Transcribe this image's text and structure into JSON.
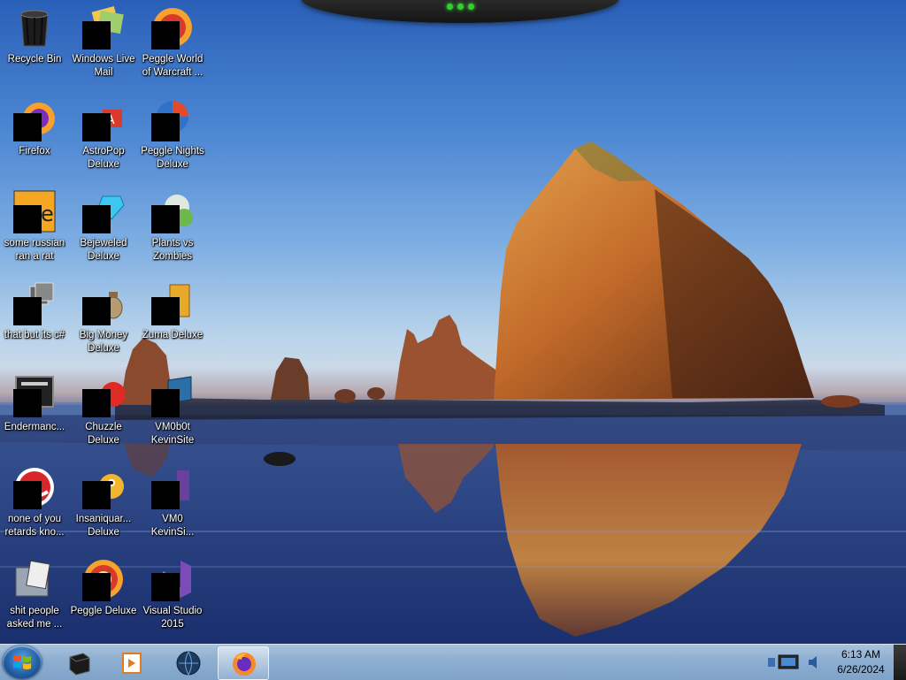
{
  "desktop": {
    "icons": [
      {
        "label": "Recycle Bin",
        "icon": "recycle-bin-icon"
      },
      {
        "label": "Windows Live\nMail",
        "icon": "windows-live-mail-icon"
      },
      {
        "label": "Peggle World\nof Warcraft ...",
        "icon": "peggle-wow-icon"
      },
      {
        "label": "Firefox",
        "icon": "firefox-icon"
      },
      {
        "label": "AstroPop\nDeluxe",
        "icon": "astropop-icon"
      },
      {
        "label": "Peggle Nights\nDeluxe",
        "icon": "peggle-nights-icon"
      },
      {
        "label": "some russian\nran a rat",
        "icon": "russian-app-icon"
      },
      {
        "label": "Bejeweled\nDeluxe",
        "icon": "bejeweled-icon"
      },
      {
        "label": "Plants vs\nZombies",
        "icon": "plants-vs-zombies-icon"
      },
      {
        "label": "that but its c#",
        "icon": "shortcut-stack-icon"
      },
      {
        "label": "Big Money\nDeluxe",
        "icon": "big-money-icon"
      },
      {
        "label": "Zuma Deluxe",
        "icon": "zuma-icon"
      },
      {
        "label": "Endermanc...",
        "icon": "endermanch-icon"
      },
      {
        "label": "Chuzzle\nDeluxe",
        "icon": "chuzzle-icon"
      },
      {
        "label": "VM0b0t\nKevinSite",
        "icon": "vm-folder-icon"
      },
      {
        "label": "none of you\nretards kno...",
        "icon": "red-ball-icon"
      },
      {
        "label": "Insaniquar...\nDeluxe",
        "icon": "insaniquarium-icon"
      },
      {
        "label": "VM0\nKevinSi...",
        "icon": "vm-purple-icon"
      },
      {
        "label": "shit people\nasked me ...",
        "icon": "folder-doc-icon"
      },
      {
        "label": "Peggle Deluxe",
        "icon": "peggle-icon"
      },
      {
        "label": "Visual Studio\n2015",
        "icon": "visual-studio-icon"
      }
    ]
  },
  "taskbar": {
    "pinned": [
      {
        "name": "black-cube-app",
        "icon": "black-cube-icon"
      },
      {
        "name": "media-player",
        "icon": "media-player-icon"
      },
      {
        "name": "globe-app",
        "icon": "globe-icon"
      },
      {
        "name": "firefox",
        "icon": "firefox-icon",
        "active": true
      }
    ],
    "tray": [
      "network-icon",
      "volume-icon"
    ],
    "clock": {
      "time": "6:13 AM",
      "date": "6/26/2024"
    }
  }
}
